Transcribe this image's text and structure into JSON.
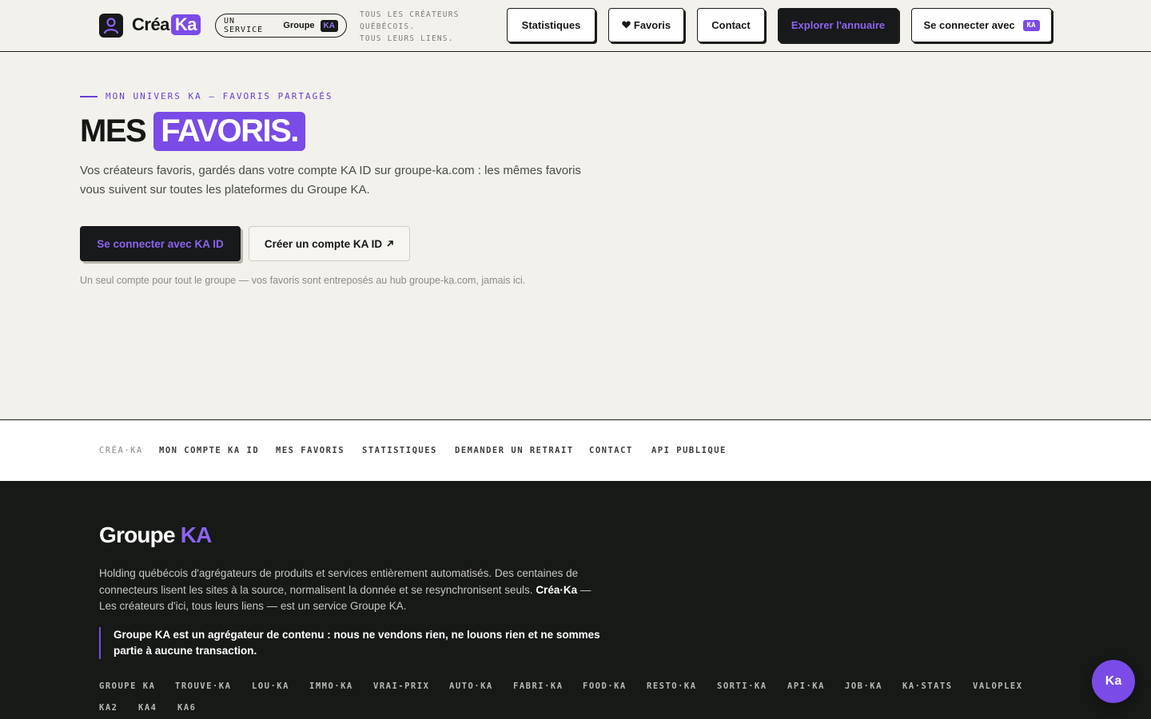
{
  "header": {
    "logo_text": "Créa",
    "logo_ka": "Ka",
    "service": {
      "label": "UN SERVICE",
      "groupe": "Groupe",
      "badge": "KA"
    },
    "tagline": [
      "TOUS LES CRÉATEURS",
      "QUÉBÉCOIS.",
      "TOUS LEURS LIENS."
    ],
    "nav": {
      "stats": "Statistiques",
      "favoris": "Favoris",
      "contact": "Contact",
      "explorer": "Explorer l'annuaire",
      "connect": "Se connecter avec",
      "connect_badge": "KA"
    }
  },
  "hero": {
    "eyebrow": "MON UNIVERS KA — FAVORIS PARTAGÉS",
    "title_plain": "MES",
    "title_highlight": "FAVORIS.",
    "description": "Vos créateurs favoris, gardés dans votre compte KA ID sur groupe-ka.com : les mêmes favoris vous suivent sur toutes les plateformes du Groupe KA.",
    "primary_button": "Se connecter avec KA ID",
    "secondary_button": "Créer un compte KA ID",
    "note": "Un seul compte pour tout le groupe — vos favoris sont entreposés au hub groupe-ka.com, jamais ici."
  },
  "footer_nav": {
    "brand": "CRÉA·KA",
    "items": [
      "MON COMPTE KA ID",
      "MES FAVORIS",
      "STATISTIQUES",
      "DEMANDER UN RETRAIT",
      "CONTACT",
      "API PUBLIQUE"
    ]
  },
  "footer": {
    "title_plain": "Groupe",
    "title_accent": "KA",
    "desc_part1": "Holding québécois d'agrégateurs de produits et services entièrement automatisés. Des centaines de connecteurs lisent les sites à la source, normalisent la donnée et se resynchronisent seuls.",
    "desc_bold": "Créa·Ka",
    "desc_part2": "— Les créateurs d'ici, tous leurs liens — est un service Groupe KA.",
    "quote": "Groupe KA est un agrégateur de contenu : nous ne vendons rien, ne louons rien et ne sommes partie à aucune transaction.",
    "links": [
      "GROUPE KA",
      "TROUVE·KA",
      "LOU·KA",
      "IMMO·KA",
      "VRAI-PRIX",
      "AUTO·KA",
      "FABRI·KA",
      "FOOD·KA",
      "RESTO·KA",
      "SORTI·KA",
      "API·KA",
      "JOB·KA",
      "KA·STATS",
      "VALOPLEX",
      "KA2",
      "KA4",
      "KA6"
    ]
  },
  "chat": {
    "label": "Ka"
  }
}
